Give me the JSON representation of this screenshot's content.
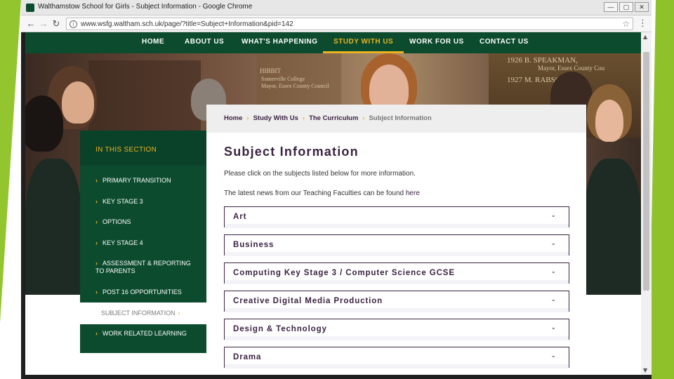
{
  "browser": {
    "tab_title": "Walthamstow School for Girls - Subject Information - Google Chrome",
    "url": "www.wsfg.waltham.sch.uk/page/?title=Subject+Information&pid=142",
    "controls": {
      "minimize": "—",
      "maximize": "▢",
      "close": "✕"
    },
    "back_glyph": "←",
    "forward_glyph": "→",
    "reload_glyph": "↻",
    "info_glyph": "i",
    "star_glyph": "☆",
    "menu_glyph": "⋮",
    "scroll_up_glyph": "▲",
    "scroll_down_glyph": "▼"
  },
  "nav": {
    "items": [
      {
        "label": "HOME"
      },
      {
        "label": "ABOUT US"
      },
      {
        "label": "WHAT'S HAPPENING"
      },
      {
        "label": "STUDY WITH US",
        "active": true
      },
      {
        "label": "WORK FOR US"
      },
      {
        "label": "CONTACT US"
      }
    ]
  },
  "hero": {
    "board_lines": [
      "1926  B. SPEAKMAN,",
      "Mayor, Essex County Cou",
      "1927  M. RABSO",
      "HIBBIT",
      "Somerville College",
      "Mayor, Essex County Council"
    ]
  },
  "section": {
    "heading": "IN THIS SECTION",
    "chevron": "›",
    "items": [
      {
        "label": "PRIMARY TRANSITION"
      },
      {
        "label": "KEY STAGE 3"
      },
      {
        "label": "OPTIONS"
      },
      {
        "label": "KEY STAGE 4"
      },
      {
        "label": "ASSESSMENT & REPORTING TO PARENTS"
      },
      {
        "label": "POST 16 OPPORTUNITIES"
      },
      {
        "label": "SUBJECT INFORMATION",
        "current": true
      },
      {
        "label": "WORK RELATED LEARNING"
      }
    ]
  },
  "breadcrumb": {
    "items": [
      "Home",
      "Study With Us",
      "The Curriculum"
    ],
    "current": "Subject Information",
    "separator": "›"
  },
  "content": {
    "title": "Subject Information",
    "intro": "Please click on the subjects listed below for more information.",
    "news_prefix": "The latest news from our Teaching Faculties can be found ",
    "news_link": "here"
  },
  "subjects": [
    {
      "label": "Art"
    },
    {
      "label": "Business"
    },
    {
      "label": "Computing Key Stage 3 / Computer Science GCSE"
    },
    {
      "label": "Creative Digital Media Production"
    },
    {
      "label": "Design & Technology"
    },
    {
      "label": "Drama"
    }
  ],
  "colors": {
    "brand_green": "#0c4b2e",
    "accent_gold": "#e9b323",
    "heading_purple": "#3b2342",
    "slide_green": "#8fc12b"
  }
}
